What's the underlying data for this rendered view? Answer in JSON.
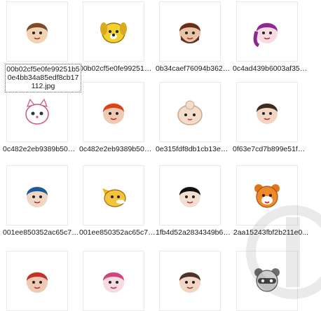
{
  "files": [
    {
      "name": "00b02cf5e0fe99251b50e4bb34a85edf8cb17112.jpg",
      "label": "00b02cf5e0fe99251b50e4bb34a85edf8cb17112.jpg",
      "icon": "boy-brown-hair-avatar-icon",
      "selected": true
    },
    {
      "name": "00b02cf5e0fe99251 4f...",
      "label": "00b02cf5e0fe992514f...",
      "icon": "yellow-dog-avatar-icon",
      "selected": false
    },
    {
      "name": "0b34caef76094b362fc...",
      "label": "0b34caef76094b362fc...",
      "icon": "bearded-man-avatar-icon",
      "selected": false
    },
    {
      "name": "0c4ad439b6003af353f...",
      "label": "0c4ad439b6003af353f...",
      "icon": "purple-hair-girl-avatar-icon",
      "selected": false
    },
    {
      "name": "0c482e2eb9389b50dc...",
      "label": "0c482e2eb9389b50dc...",
      "icon": "pink-cat-avatar-icon",
      "selected": false
    },
    {
      "name": "0c482e2eb9389b50de...",
      "label": "0c482e2eb9389b50de...",
      "icon": "red-hair-man-avatar-icon",
      "selected": false
    },
    {
      "name": "0e315fdf8db1cb13e43...",
      "label": "0e315fdf8db1cb13e43...",
      "icon": "bun-character-avatar-icon",
      "selected": false
    },
    {
      "name": "0f63e7cd7b899e51fdc...",
      "label": "0f63e7cd7b899e51fdc...",
      "icon": "dark-hair-man-avatar-icon",
      "selected": false
    },
    {
      "name": "001ee850352ac65c7d...",
      "label": "001ee850352ac65c7d...",
      "icon": "blue-hair-man-avatar-icon",
      "selected": false
    },
    {
      "name": "001ee850352ac65c7e...",
      "label": "001ee850352ac65c7e...",
      "icon": "yellow-fox-avatar-icon",
      "selected": false
    },
    {
      "name": "1fb4d52a2834349b61...",
      "label": "1fb4d52a2834349b61...",
      "icon": "black-hair-boy-avatar-icon",
      "selected": false
    },
    {
      "name": "2aa15243fbf2b211e0...",
      "label": "2aa15243fbf2b211e0...",
      "icon": "orange-bear-avatar-icon",
      "selected": false
    },
    {
      "name": "",
      "label": "",
      "icon": "red-hair-avatar-icon",
      "selected": false
    },
    {
      "name": "",
      "label": "",
      "icon": "pink-hair-avatar-icon",
      "selected": false
    },
    {
      "name": "",
      "label": "",
      "icon": "dark-hair-avatar-icon",
      "selected": false
    },
    {
      "name": "",
      "label": "",
      "icon": "gray-raccoon-avatar-icon",
      "selected": false
    }
  ],
  "colors": {
    "selection_border": "#555555",
    "thumb_border": "#e9e9e9",
    "text": "#1a1a1a"
  }
}
